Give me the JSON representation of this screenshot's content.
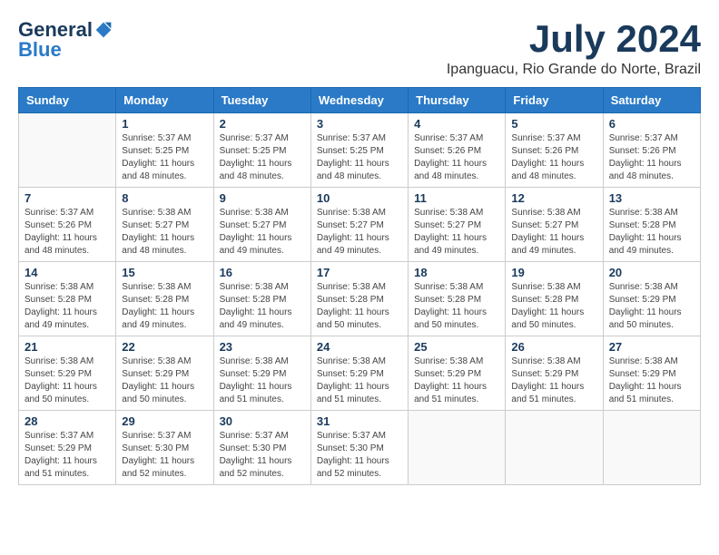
{
  "header": {
    "logo_general": "General",
    "logo_blue": "Blue",
    "month_title": "July 2024",
    "subtitle": "Ipanguacu, Rio Grande do Norte, Brazil"
  },
  "days_of_week": [
    "Sunday",
    "Monday",
    "Tuesday",
    "Wednesday",
    "Thursday",
    "Friday",
    "Saturday"
  ],
  "weeks": [
    [
      {
        "day": "",
        "sunrise": "",
        "sunset": "",
        "daylight": ""
      },
      {
        "day": "1",
        "sunrise": "Sunrise: 5:37 AM",
        "sunset": "Sunset: 5:25 PM",
        "daylight": "Daylight: 11 hours and 48 minutes."
      },
      {
        "day": "2",
        "sunrise": "Sunrise: 5:37 AM",
        "sunset": "Sunset: 5:25 PM",
        "daylight": "Daylight: 11 hours and 48 minutes."
      },
      {
        "day": "3",
        "sunrise": "Sunrise: 5:37 AM",
        "sunset": "Sunset: 5:25 PM",
        "daylight": "Daylight: 11 hours and 48 minutes."
      },
      {
        "day": "4",
        "sunrise": "Sunrise: 5:37 AM",
        "sunset": "Sunset: 5:26 PM",
        "daylight": "Daylight: 11 hours and 48 minutes."
      },
      {
        "day": "5",
        "sunrise": "Sunrise: 5:37 AM",
        "sunset": "Sunset: 5:26 PM",
        "daylight": "Daylight: 11 hours and 48 minutes."
      },
      {
        "day": "6",
        "sunrise": "Sunrise: 5:37 AM",
        "sunset": "Sunset: 5:26 PM",
        "daylight": "Daylight: 11 hours and 48 minutes."
      }
    ],
    [
      {
        "day": "7",
        "sunrise": "Sunrise: 5:37 AM",
        "sunset": "Sunset: 5:26 PM",
        "daylight": "Daylight: 11 hours and 48 minutes."
      },
      {
        "day": "8",
        "sunrise": "Sunrise: 5:38 AM",
        "sunset": "Sunset: 5:27 PM",
        "daylight": "Daylight: 11 hours and 48 minutes."
      },
      {
        "day": "9",
        "sunrise": "Sunrise: 5:38 AM",
        "sunset": "Sunset: 5:27 PM",
        "daylight": "Daylight: 11 hours and 49 minutes."
      },
      {
        "day": "10",
        "sunrise": "Sunrise: 5:38 AM",
        "sunset": "Sunset: 5:27 PM",
        "daylight": "Daylight: 11 hours and 49 minutes."
      },
      {
        "day": "11",
        "sunrise": "Sunrise: 5:38 AM",
        "sunset": "Sunset: 5:27 PM",
        "daylight": "Daylight: 11 hours and 49 minutes."
      },
      {
        "day": "12",
        "sunrise": "Sunrise: 5:38 AM",
        "sunset": "Sunset: 5:27 PM",
        "daylight": "Daylight: 11 hours and 49 minutes."
      },
      {
        "day": "13",
        "sunrise": "Sunrise: 5:38 AM",
        "sunset": "Sunset: 5:28 PM",
        "daylight": "Daylight: 11 hours and 49 minutes."
      }
    ],
    [
      {
        "day": "14",
        "sunrise": "Sunrise: 5:38 AM",
        "sunset": "Sunset: 5:28 PM",
        "daylight": "Daylight: 11 hours and 49 minutes."
      },
      {
        "day": "15",
        "sunrise": "Sunrise: 5:38 AM",
        "sunset": "Sunset: 5:28 PM",
        "daylight": "Daylight: 11 hours and 49 minutes."
      },
      {
        "day": "16",
        "sunrise": "Sunrise: 5:38 AM",
        "sunset": "Sunset: 5:28 PM",
        "daylight": "Daylight: 11 hours and 49 minutes."
      },
      {
        "day": "17",
        "sunrise": "Sunrise: 5:38 AM",
        "sunset": "Sunset: 5:28 PM",
        "daylight": "Daylight: 11 hours and 50 minutes."
      },
      {
        "day": "18",
        "sunrise": "Sunrise: 5:38 AM",
        "sunset": "Sunset: 5:28 PM",
        "daylight": "Daylight: 11 hours and 50 minutes."
      },
      {
        "day": "19",
        "sunrise": "Sunrise: 5:38 AM",
        "sunset": "Sunset: 5:28 PM",
        "daylight": "Daylight: 11 hours and 50 minutes."
      },
      {
        "day": "20",
        "sunrise": "Sunrise: 5:38 AM",
        "sunset": "Sunset: 5:29 PM",
        "daylight": "Daylight: 11 hours and 50 minutes."
      }
    ],
    [
      {
        "day": "21",
        "sunrise": "Sunrise: 5:38 AM",
        "sunset": "Sunset: 5:29 PM",
        "daylight": "Daylight: 11 hours and 50 minutes."
      },
      {
        "day": "22",
        "sunrise": "Sunrise: 5:38 AM",
        "sunset": "Sunset: 5:29 PM",
        "daylight": "Daylight: 11 hours and 50 minutes."
      },
      {
        "day": "23",
        "sunrise": "Sunrise: 5:38 AM",
        "sunset": "Sunset: 5:29 PM",
        "daylight": "Daylight: 11 hours and 51 minutes."
      },
      {
        "day": "24",
        "sunrise": "Sunrise: 5:38 AM",
        "sunset": "Sunset: 5:29 PM",
        "daylight": "Daylight: 11 hours and 51 minutes."
      },
      {
        "day": "25",
        "sunrise": "Sunrise: 5:38 AM",
        "sunset": "Sunset: 5:29 PM",
        "daylight": "Daylight: 11 hours and 51 minutes."
      },
      {
        "day": "26",
        "sunrise": "Sunrise: 5:38 AM",
        "sunset": "Sunset: 5:29 PM",
        "daylight": "Daylight: 11 hours and 51 minutes."
      },
      {
        "day": "27",
        "sunrise": "Sunrise: 5:38 AM",
        "sunset": "Sunset: 5:29 PM",
        "daylight": "Daylight: 11 hours and 51 minutes."
      }
    ],
    [
      {
        "day": "28",
        "sunrise": "Sunrise: 5:37 AM",
        "sunset": "Sunset: 5:29 PM",
        "daylight": "Daylight: 11 hours and 51 minutes."
      },
      {
        "day": "29",
        "sunrise": "Sunrise: 5:37 AM",
        "sunset": "Sunset: 5:30 PM",
        "daylight": "Daylight: 11 hours and 52 minutes."
      },
      {
        "day": "30",
        "sunrise": "Sunrise: 5:37 AM",
        "sunset": "Sunset: 5:30 PM",
        "daylight": "Daylight: 11 hours and 52 minutes."
      },
      {
        "day": "31",
        "sunrise": "Sunrise: 5:37 AM",
        "sunset": "Sunset: 5:30 PM",
        "daylight": "Daylight: 11 hours and 52 minutes."
      },
      {
        "day": "",
        "sunrise": "",
        "sunset": "",
        "daylight": ""
      },
      {
        "day": "",
        "sunrise": "",
        "sunset": "",
        "daylight": ""
      },
      {
        "day": "",
        "sunrise": "",
        "sunset": "",
        "daylight": ""
      }
    ]
  ]
}
